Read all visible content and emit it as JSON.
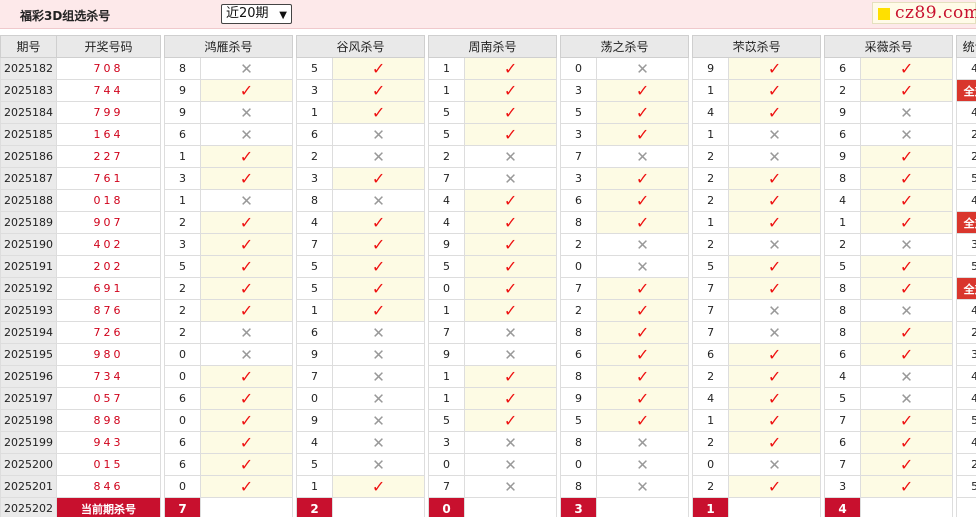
{
  "header": {
    "title": "福彩3D组选杀号",
    "period_select": "近20期",
    "logo_text": "cz89.com"
  },
  "columns": {
    "issue": "期号",
    "draw": "开奖号码",
    "experts": [
      "鸿雁杀号",
      "谷风杀号",
      "周南杀号",
      "荡之杀号",
      "芣苡杀号",
      "采薇杀号"
    ],
    "stat": "统计"
  },
  "rows": [
    {
      "issue": "2025182",
      "draw": "708",
      "picks": [
        [
          "8",
          "x"
        ],
        [
          "5",
          "v"
        ],
        [
          "1",
          "v"
        ],
        [
          "0",
          "x"
        ],
        [
          "9",
          "v"
        ],
        [
          "6",
          "v"
        ]
      ],
      "stat": "4"
    },
    {
      "issue": "2025183",
      "draw": "744",
      "picks": [
        [
          "9",
          "v"
        ],
        [
          "3",
          "v"
        ],
        [
          "1",
          "v"
        ],
        [
          "3",
          "v"
        ],
        [
          "1",
          "v"
        ],
        [
          "2",
          "v"
        ]
      ],
      "stat": "全对"
    },
    {
      "issue": "2025184",
      "draw": "799",
      "picks": [
        [
          "9",
          "x"
        ],
        [
          "1",
          "v"
        ],
        [
          "5",
          "v"
        ],
        [
          "5",
          "v"
        ],
        [
          "4",
          "v"
        ],
        [
          "9",
          "x"
        ]
      ],
      "stat": "4"
    },
    {
      "issue": "2025185",
      "draw": "164",
      "picks": [
        [
          "6",
          "x"
        ],
        [
          "6",
          "x"
        ],
        [
          "5",
          "v"
        ],
        [
          "3",
          "v"
        ],
        [
          "1",
          "x"
        ],
        [
          "6",
          "x"
        ]
      ],
      "stat": "2"
    },
    {
      "issue": "2025186",
      "draw": "227",
      "picks": [
        [
          "1",
          "v"
        ],
        [
          "2",
          "x"
        ],
        [
          "2",
          "x"
        ],
        [
          "7",
          "x"
        ],
        [
          "2",
          "x"
        ],
        [
          "9",
          "v"
        ]
      ],
      "stat": "2"
    },
    {
      "issue": "2025187",
      "draw": "761",
      "picks": [
        [
          "3",
          "v"
        ],
        [
          "3",
          "v"
        ],
        [
          "7",
          "x"
        ],
        [
          "3",
          "v"
        ],
        [
          "2",
          "v"
        ],
        [
          "8",
          "v"
        ]
      ],
      "stat": "5"
    },
    {
      "issue": "2025188",
      "draw": "018",
      "picks": [
        [
          "1",
          "x"
        ],
        [
          "8",
          "x"
        ],
        [
          "4",
          "v"
        ],
        [
          "6",
          "v"
        ],
        [
          "2",
          "v"
        ],
        [
          "4",
          "v"
        ]
      ],
      "stat": "4"
    },
    {
      "issue": "2025189",
      "draw": "907",
      "picks": [
        [
          "2",
          "v"
        ],
        [
          "4",
          "v"
        ],
        [
          "4",
          "v"
        ],
        [
          "8",
          "v"
        ],
        [
          "1",
          "v"
        ],
        [
          "1",
          "v"
        ]
      ],
      "stat": "全对"
    },
    {
      "issue": "2025190",
      "draw": "402",
      "picks": [
        [
          "3",
          "v"
        ],
        [
          "7",
          "v"
        ],
        [
          "9",
          "v"
        ],
        [
          "2",
          "x"
        ],
        [
          "2",
          "x"
        ],
        [
          "2",
          "x"
        ]
      ],
      "stat": "3"
    },
    {
      "issue": "2025191",
      "draw": "202",
      "picks": [
        [
          "5",
          "v"
        ],
        [
          "5",
          "v"
        ],
        [
          "5",
          "v"
        ],
        [
          "0",
          "x"
        ],
        [
          "5",
          "v"
        ],
        [
          "5",
          "v"
        ]
      ],
      "stat": "5"
    },
    {
      "issue": "2025192",
      "draw": "691",
      "picks": [
        [
          "2",
          "v"
        ],
        [
          "5",
          "v"
        ],
        [
          "0",
          "v"
        ],
        [
          "7",
          "v"
        ],
        [
          "7",
          "v"
        ],
        [
          "8",
          "v"
        ]
      ],
      "stat": "全对"
    },
    {
      "issue": "2025193",
      "draw": "876",
      "picks": [
        [
          "2",
          "v"
        ],
        [
          "1",
          "v"
        ],
        [
          "1",
          "v"
        ],
        [
          "2",
          "v"
        ],
        [
          "7",
          "x"
        ],
        [
          "8",
          "x"
        ]
      ],
      "stat": "4"
    },
    {
      "issue": "2025194",
      "draw": "726",
      "picks": [
        [
          "2",
          "x"
        ],
        [
          "6",
          "x"
        ],
        [
          "7",
          "x"
        ],
        [
          "8",
          "v"
        ],
        [
          "7",
          "x"
        ],
        [
          "8",
          "v"
        ]
      ],
      "stat": "2"
    },
    {
      "issue": "2025195",
      "draw": "980",
      "picks": [
        [
          "0",
          "x"
        ],
        [
          "9",
          "x"
        ],
        [
          "9",
          "x"
        ],
        [
          "6",
          "v"
        ],
        [
          "6",
          "v"
        ],
        [
          "6",
          "v"
        ]
      ],
      "stat": "3"
    },
    {
      "issue": "2025196",
      "draw": "734",
      "picks": [
        [
          "0",
          "v"
        ],
        [
          "7",
          "x"
        ],
        [
          "1",
          "v"
        ],
        [
          "8",
          "v"
        ],
        [
          "2",
          "v"
        ],
        [
          "4",
          "x"
        ]
      ],
      "stat": "4"
    },
    {
      "issue": "2025197",
      "draw": "057",
      "picks": [
        [
          "6",
          "v"
        ],
        [
          "0",
          "x"
        ],
        [
          "1",
          "v"
        ],
        [
          "9",
          "v"
        ],
        [
          "4",
          "v"
        ],
        [
          "5",
          "x"
        ]
      ],
      "stat": "4"
    },
    {
      "issue": "2025198",
      "draw": "898",
      "picks": [
        [
          "0",
          "v"
        ],
        [
          "9",
          "x"
        ],
        [
          "5",
          "v"
        ],
        [
          "5",
          "v"
        ],
        [
          "1",
          "v"
        ],
        [
          "7",
          "v"
        ]
      ],
      "stat": "5"
    },
    {
      "issue": "2025199",
      "draw": "943",
      "picks": [
        [
          "6",
          "v"
        ],
        [
          "4",
          "x"
        ],
        [
          "3",
          "x"
        ],
        [
          "8",
          "x"
        ],
        [
          "2",
          "v"
        ],
        [
          "6",
          "v"
        ]
      ],
      "stat": "4"
    },
    {
      "issue": "2025200",
      "draw": "015",
      "picks": [
        [
          "6",
          "v"
        ],
        [
          "5",
          "x"
        ],
        [
          "0",
          "x"
        ],
        [
          "0",
          "x"
        ],
        [
          "0",
          "x"
        ],
        [
          "7",
          "v"
        ]
      ],
      "stat": "2"
    },
    {
      "issue": "2025201",
      "draw": "846",
      "picks": [
        [
          "0",
          "v"
        ],
        [
          "1",
          "v"
        ],
        [
          "7",
          "x"
        ],
        [
          "8",
          "x"
        ],
        [
          "2",
          "v"
        ],
        [
          "3",
          "v"
        ]
      ],
      "stat": "5"
    }
  ],
  "current": {
    "issue": "2025202",
    "label": "当前期杀号",
    "picks": [
      "7",
      "2",
      "0",
      "3",
      "1",
      "4"
    ]
  },
  "icons": {
    "hit": "check-icon",
    "miss": "cross-icon"
  },
  "colors": {
    "hit": "#ee1111",
    "miss": "#999999",
    "draw": "#d0021b",
    "full_badge": "#d9362d",
    "current_row": "#c8102e"
  }
}
